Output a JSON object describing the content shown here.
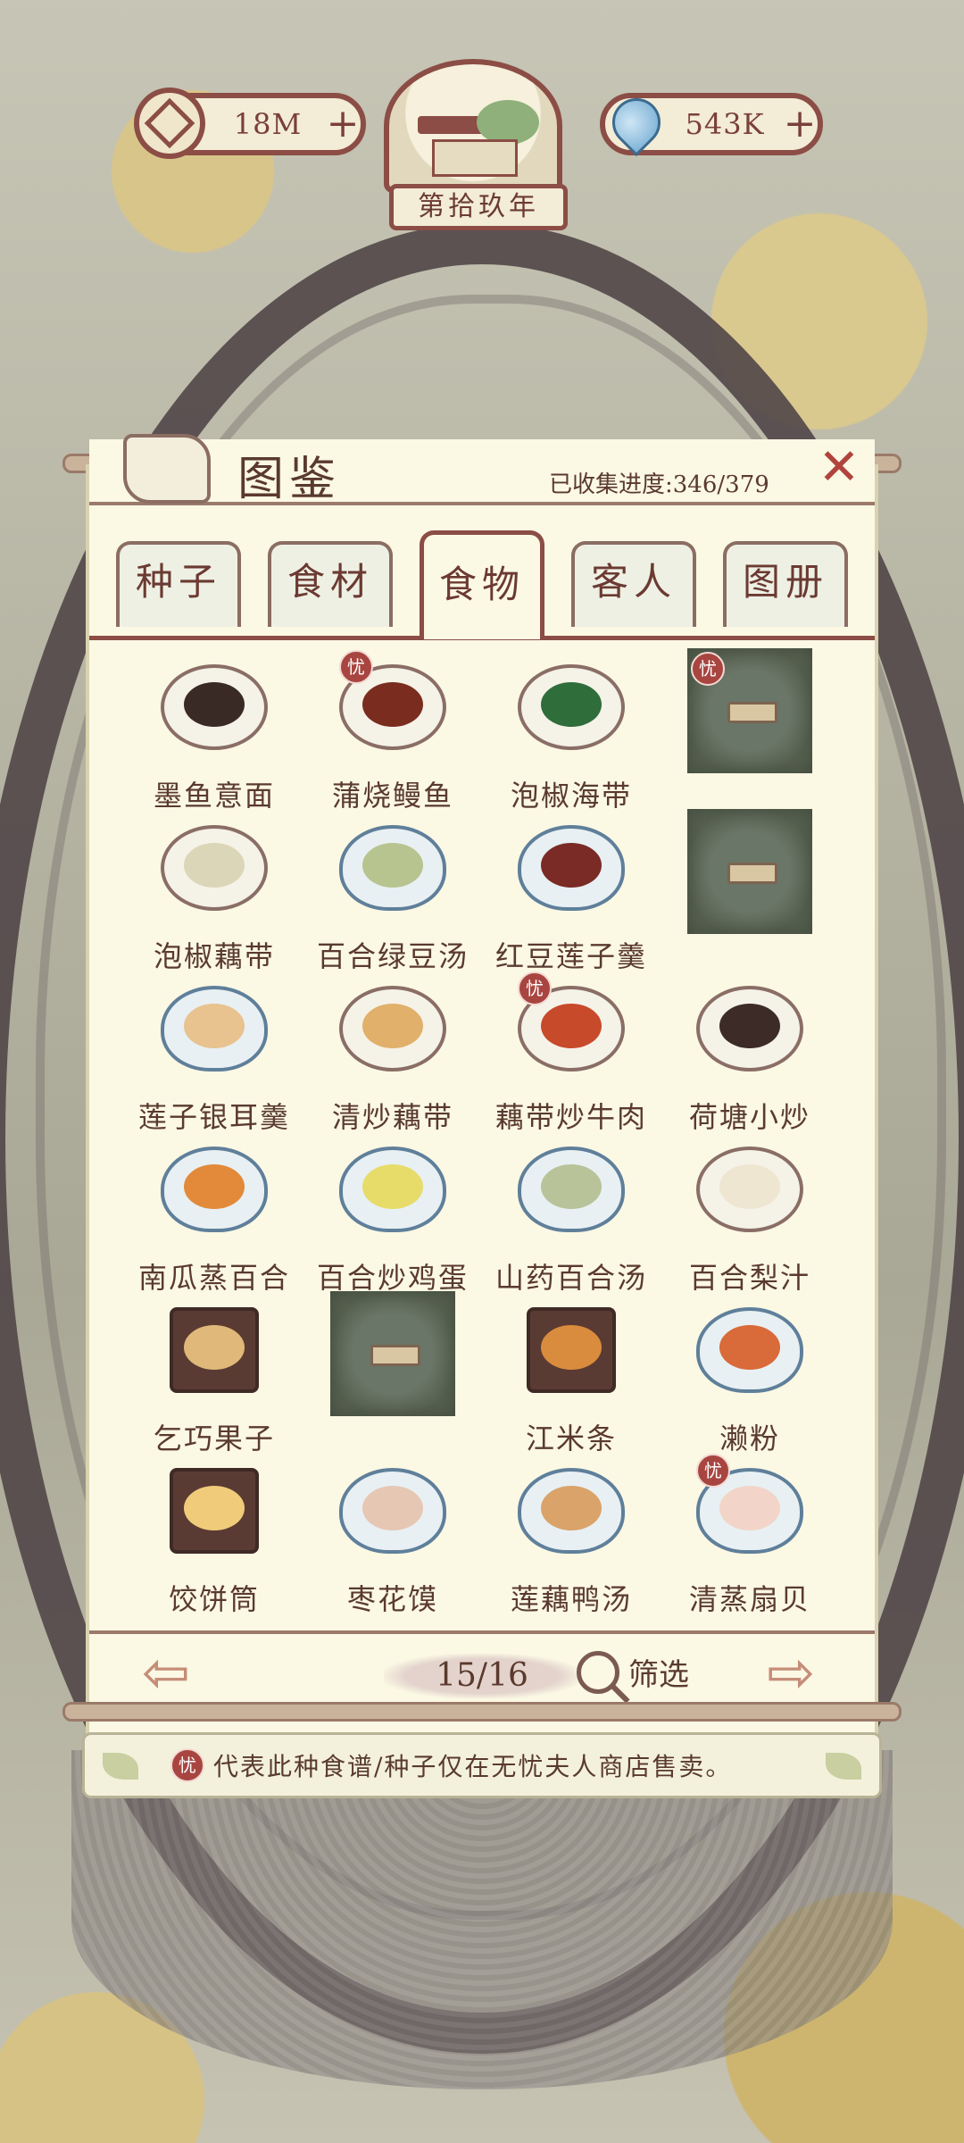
{
  "hud": {
    "coins": "18M",
    "water": "543K",
    "year": "第拾玖年",
    "icons": [
      "coin-icon",
      "water-drop-icon",
      "plus-icon"
    ]
  },
  "panel": {
    "title": "图鉴",
    "progress": "已收集进度:346/379",
    "close_icon": "close-icon"
  },
  "tabs": [
    {
      "label": "种子",
      "active": false
    },
    {
      "label": "食材",
      "active": false
    },
    {
      "label": "食物",
      "active": true
    },
    {
      "label": "客人",
      "active": false
    },
    {
      "label": "图册",
      "active": false
    }
  ],
  "badge_char": "忧",
  "items": [
    {
      "name": "墨鱼意面",
      "locked": false,
      "badge": false,
      "food": "#3a2a26",
      "style": "plate"
    },
    {
      "name": "蒲烧鳗鱼",
      "locked": false,
      "badge": true,
      "food": "#7a2d1f",
      "style": "plate"
    },
    {
      "name": "泡椒海带",
      "locked": false,
      "badge": false,
      "food": "#2f6d3a",
      "style": "plate"
    },
    {
      "name": "",
      "locked": true,
      "badge": true
    },
    {
      "name": "泡椒藕带",
      "locked": false,
      "badge": false,
      "food": "#dcd6b8",
      "style": "plate"
    },
    {
      "name": "百合绿豆汤",
      "locked": false,
      "badge": false,
      "food": "#b7c48f",
      "style": "bowl"
    },
    {
      "name": "红豆莲子羹",
      "locked": false,
      "badge": false,
      "food": "#7a2b25",
      "style": "bowl"
    },
    {
      "name": "",
      "locked": true,
      "badge": false
    },
    {
      "name": "莲子银耳羹",
      "locked": false,
      "badge": false,
      "food": "#e8c28f",
      "style": "bowl"
    },
    {
      "name": "清炒藕带",
      "locked": false,
      "badge": false,
      "food": "#e1b06a",
      "style": "plate"
    },
    {
      "name": "藕带炒牛肉",
      "locked": false,
      "badge": true,
      "food": "#c74a2a",
      "style": "plate"
    },
    {
      "name": "荷塘小炒",
      "locked": false,
      "badge": false,
      "food": "#3d2b27",
      "style": "plate"
    },
    {
      "name": "南瓜蒸百合",
      "locked": false,
      "badge": false,
      "food": "#e28a3a",
      "style": "bowl"
    },
    {
      "name": "百合炒鸡蛋",
      "locked": false,
      "badge": false,
      "food": "#e7dc6a",
      "style": "bowl"
    },
    {
      "name": "山药百合汤",
      "locked": false,
      "badge": false,
      "food": "#b8c39a",
      "style": "bowl"
    },
    {
      "name": "百合梨汁",
      "locked": false,
      "badge": false,
      "food": "#efe6d2",
      "style": "plate"
    },
    {
      "name": "乞巧果子",
      "locked": false,
      "badge": false,
      "food": "#e0b97a",
      "style": "square"
    },
    {
      "name": "",
      "locked": true,
      "badge": false
    },
    {
      "name": "江米条",
      "locked": false,
      "badge": false,
      "food": "#d98c3d",
      "style": "square"
    },
    {
      "name": "濑粉",
      "locked": false,
      "badge": false,
      "food": "#d96a3a",
      "style": "bowl"
    },
    {
      "name": "饺饼筒",
      "locked": false,
      "badge": false,
      "food": "#f0cc7a",
      "style": "square"
    },
    {
      "name": "枣花馍",
      "locked": false,
      "badge": false,
      "food": "#e6c7b4",
      "style": "bowl"
    },
    {
      "name": "莲藕鸭汤",
      "locked": false,
      "badge": false,
      "food": "#d9a36a",
      "style": "bowl"
    },
    {
      "name": "清蒸扇贝",
      "locked": false,
      "badge": true,
      "food": "#f2d5c8",
      "style": "bowl"
    }
  ],
  "pager": {
    "page": "15/16",
    "filter": "筛选",
    "prev_icon": "arrow-left-icon",
    "next_icon": "arrow-right-icon"
  },
  "note": {
    "text": "代表此种食谱/种子仅在无忧夫人商店售卖。"
  }
}
